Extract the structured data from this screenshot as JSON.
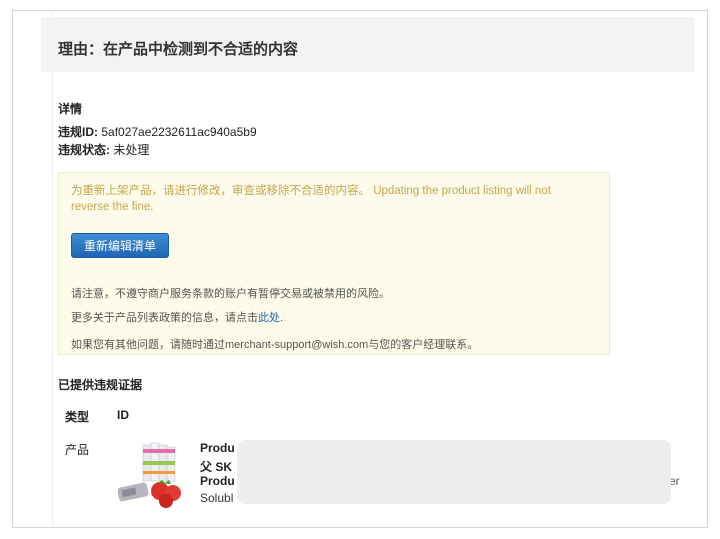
{
  "reason": "理由：在产品中检测到不合适的内容",
  "details": {
    "title": "详情",
    "violation_id_label": "违规ID:",
    "violation_id_value": "5af027ae2232611ac940a5b9",
    "status_label": "违规状态:",
    "status_value": "未处理"
  },
  "notice": {
    "warning": "为重新上架产品，请进行修改，审查或移除不合适的内容。 Updating the product listing will not reverse the fine.",
    "edit_button": "重新编辑清单",
    "note1": "请注意，不遵守商户服务条款的账户有暂停交易或被禁用的风险。",
    "note2_prefix": "更多关于产品列表政策的信息，请点击",
    "note2_link": "此处",
    "note2_suffix": ".",
    "note3": "如果您有其他问题，请随时通过merchant-support@wish.com与您的客户经理联系。"
  },
  "evidence": {
    "title": "已提供违规证据",
    "col_type": "类型",
    "col_id": "ID",
    "row_type": "产品",
    "product_lines": [
      "Produ",
      "父 SK",
      "Produ",
      "Solubl"
    ],
    "trailing_text": "er"
  },
  "colors": {
    "button": "#1e64b2",
    "link": "#1e64b2",
    "notice_bg": "#fdfbe9",
    "notice_text": "#c8a54f"
  }
}
